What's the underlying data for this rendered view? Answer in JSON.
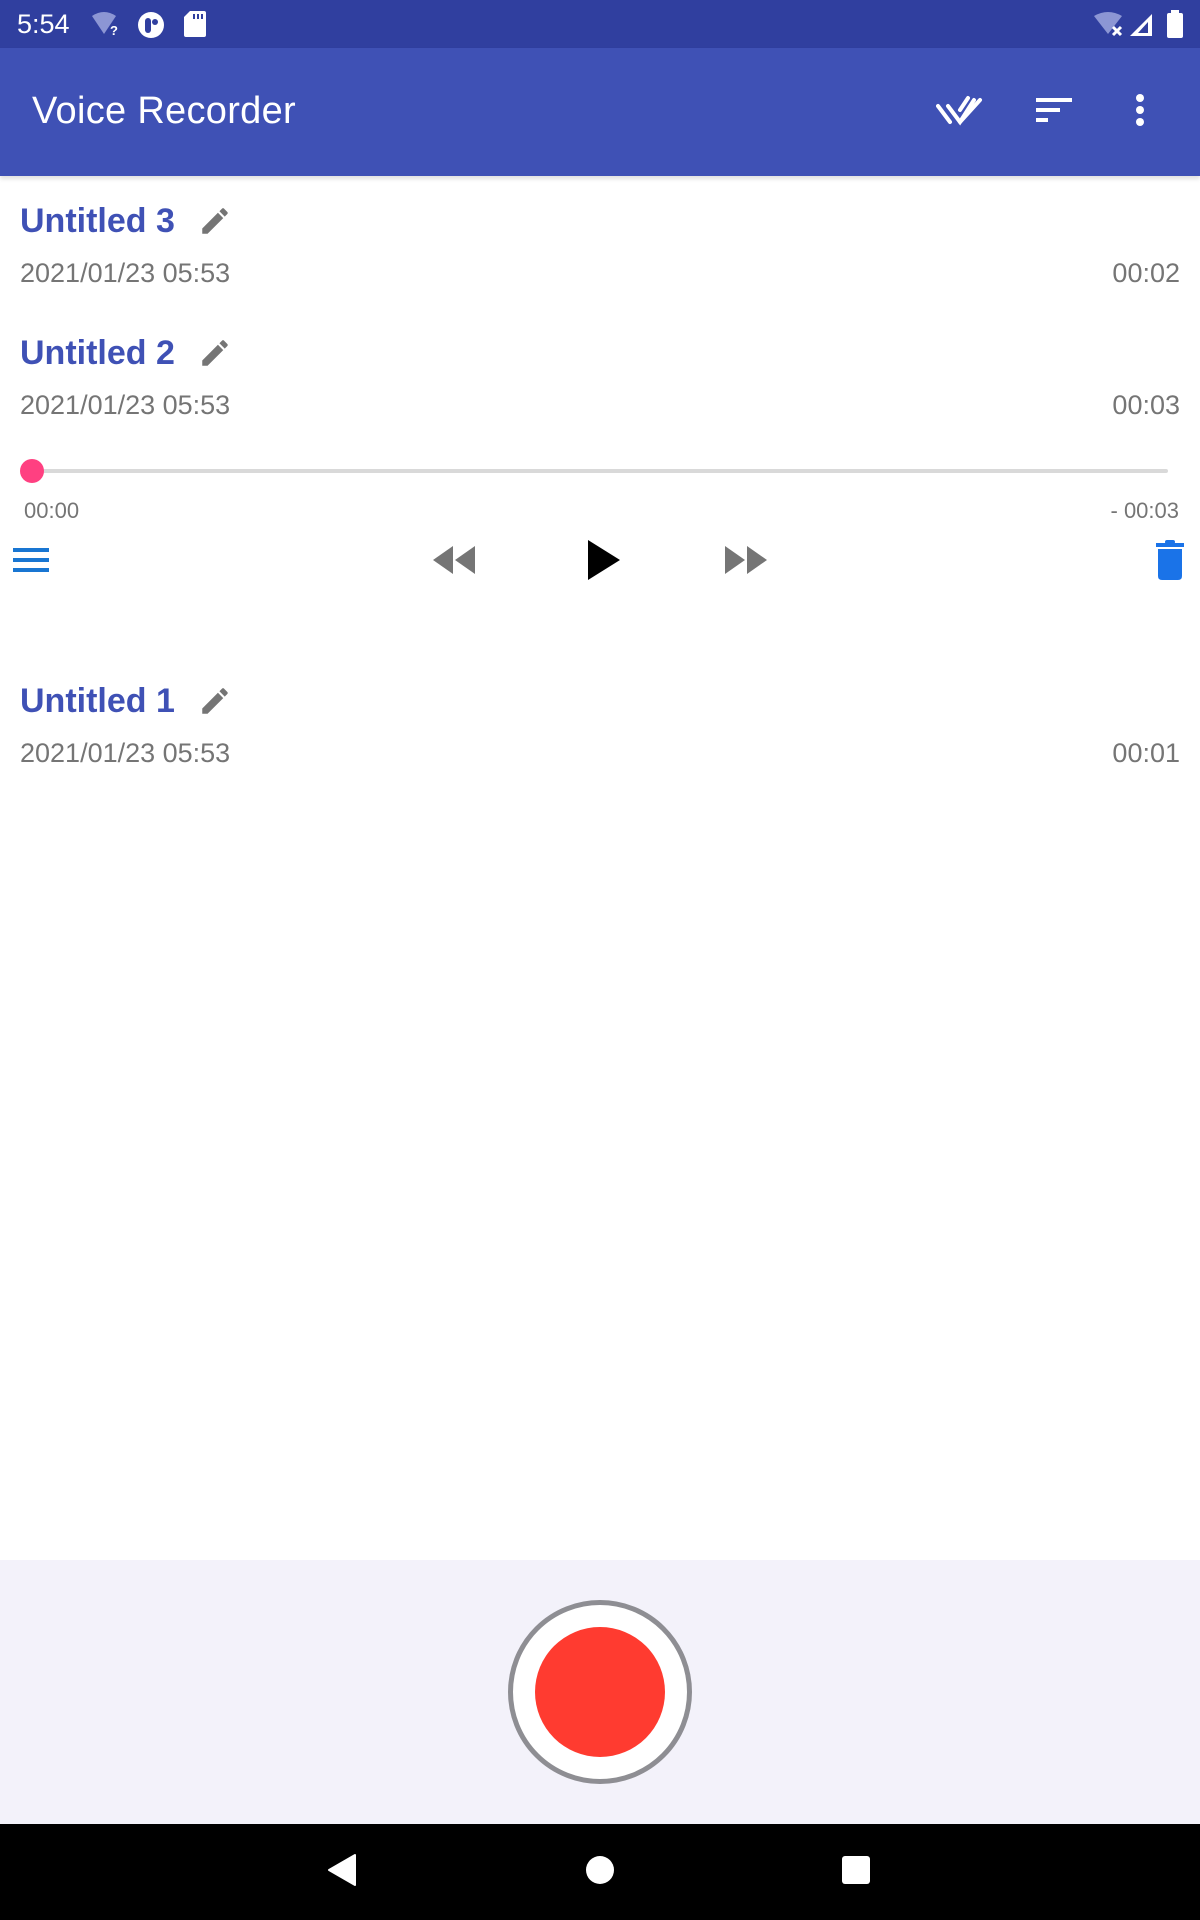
{
  "status_bar": {
    "time": "5:54",
    "icons": [
      "wifi-unknown-icon",
      "app-notification-icon",
      "sd-card-icon",
      "wifi-off-icon",
      "cell-signal-icon",
      "battery-icon"
    ]
  },
  "app_bar": {
    "title": "Voice Recorder",
    "actions": [
      {
        "name": "select-all",
        "icon": "double-check-icon"
      },
      {
        "name": "sort",
        "icon": "sort-icon"
      },
      {
        "name": "more-options",
        "icon": "more-vert-icon"
      }
    ],
    "background": "#3f51b5"
  },
  "recordings": [
    {
      "title": "Untitled 3",
      "date": "2021/01/23 05:53",
      "duration": "00:02",
      "expanded": false
    },
    {
      "title": "Untitled 2",
      "date": "2021/01/23 05:53",
      "duration": "00:03",
      "expanded": true
    },
    {
      "title": "Untitled 1",
      "date": "2021/01/23 05:53",
      "duration": "00:01",
      "expanded": false
    }
  ],
  "player": {
    "progress": 0,
    "elapsed": "00:00",
    "remaining": "- 00:03",
    "controls": [
      "menu-icon",
      "rewind-icon",
      "play-icon",
      "fast-forward-icon",
      "delete-icon"
    ],
    "accent": "#ff4081",
    "control_accent": "#1976d2"
  },
  "record_button": {
    "icon": "record-icon",
    "color": "#ff3b30"
  },
  "nav_bar": {
    "buttons": [
      "back-icon",
      "home-icon",
      "recents-icon"
    ]
  }
}
